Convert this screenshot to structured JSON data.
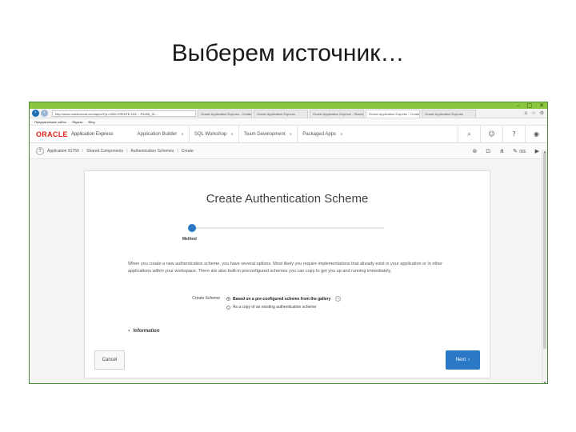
{
  "slide": {
    "title": "Выберем источник…"
  },
  "browser": {
    "window_controls": [
      "–",
      "□",
      "✕"
    ],
    "address": "http://www.oraclecloud.com/apex/f?p=4000:CREATE:103:::::P4495_ID:...",
    "tabs": [
      {
        "label": "Oracle Application Express - Create Authentication Scheme"
      },
      {
        "label": "Oracle Application Express"
      },
      {
        "label": "Oracle Application Express - Shared Components"
      },
      {
        "label": "Oracle Application Express - Create Authentication Scheme"
      },
      {
        "label": "Oracle Application Express"
      }
    ],
    "favorites": [
      "Предлагаемые сайты",
      "Яндекс",
      "Bing"
    ]
  },
  "header": {
    "logo": "ORACLE",
    "product": "Application Express",
    "menu": [
      {
        "label": "Application Builder"
      },
      {
        "label": "SQL Workshop"
      },
      {
        "label": "Team Development"
      },
      {
        "label": "Packaged Apps"
      }
    ],
    "chevron": "∨",
    "icons": [
      "search-icon",
      "user-icon",
      "help-icon",
      "account-icon"
    ]
  },
  "breadcrumb": {
    "items": [
      "Application 91750",
      "Shared Components",
      "Authentication Schemes",
      "Create"
    ],
    "separator": "\\",
    "tools": {
      "edit_label": "IDE"
    }
  },
  "wizard": {
    "title": "Create Authentication Scheme",
    "step_label": "Method",
    "intro": "When you create a new authentication scheme, you have several options. Most likely you require implementations that already exist in your application or in other applications within your workspace. There are also built-in preconfigured schemes you can copy to get you up and running immediately.",
    "field_label": "Create Scheme",
    "options": [
      {
        "label": "Based on a pre-configured scheme from the gallery",
        "selected": true
      },
      {
        "label": "As a copy of an existing authentication scheme",
        "selected": false
      }
    ],
    "help_glyph": "?",
    "info_label": "Information",
    "cancel_label": "Cancel",
    "next_label": "Next",
    "next_glyph": "›"
  },
  "colors": {
    "accent": "#2a78c6",
    "oracle_red": "#e2231a",
    "window_frame": "#8cc63f"
  }
}
